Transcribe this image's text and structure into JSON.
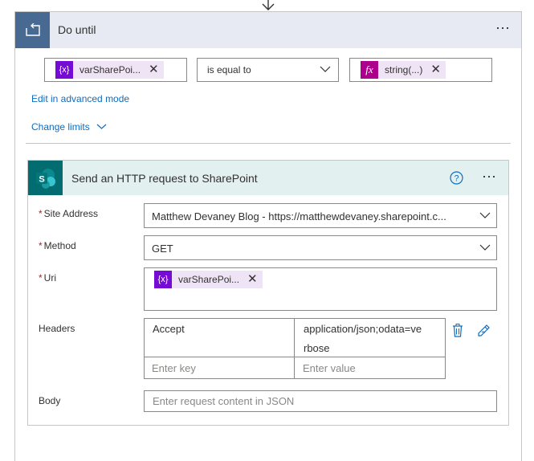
{
  "do_until": {
    "title": "Do until",
    "condition": {
      "left_token": "varSharePoi...",
      "operator": "is equal to",
      "right_token": "string(...)"
    },
    "advanced_mode_link": "Edit in advanced mode",
    "change_limits_link": "Change limits"
  },
  "http_action": {
    "title": "Send an HTTP request to SharePoint",
    "site_address": {
      "label": "Site Address",
      "value": "Matthew Devaney Blog - https://matthewdevaney.sharepoint.c..."
    },
    "method": {
      "label": "Method",
      "value": "GET"
    },
    "uri": {
      "label": "Uri",
      "token": "varSharePoi..."
    },
    "headers": {
      "label": "Headers",
      "rows": [
        {
          "key": "Accept",
          "value_line1": "application/json;odata=ve",
          "value_line2": "rbose"
        }
      ],
      "key_placeholder": "Enter key",
      "value_placeholder": "Enter value"
    },
    "body": {
      "label": "Body",
      "placeholder": "Enter request content in JSON"
    }
  },
  "icons": {
    "variable_token": "variable-icon",
    "expression_token": "fx-icon",
    "do_until": "loop-icon",
    "sharepoint": "sharepoint-icon"
  },
  "colors": {
    "do_until_header_bg": "#e7eaf2",
    "do_until_icon_bg": "#486991",
    "http_header_bg": "#e3f0f0",
    "sharepoint_icon_bg": "#036c70",
    "variable_token_icon": "#770bd6",
    "expression_token_icon": "#ad008c",
    "token_bg": "#efe4f5",
    "link": "#0f6cbd",
    "required_star": "#a4262c"
  },
  "symbols": {
    "required": "*",
    "more": "⋯",
    "remove": "✕",
    "fx": "fx",
    "var": "{x}"
  }
}
